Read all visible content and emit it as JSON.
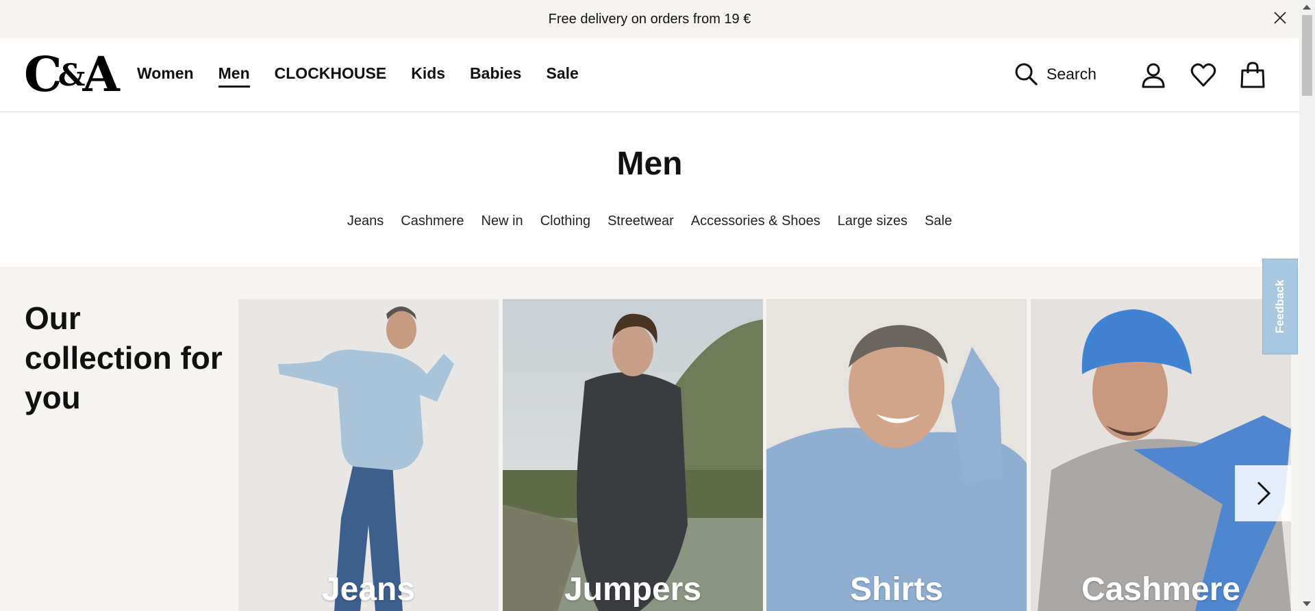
{
  "promo": {
    "text": "Free delivery on orders from 19 €"
  },
  "header": {
    "logo": {
      "left": "C",
      "amp": "&",
      "right": "A"
    },
    "nav": [
      "Women",
      "Men",
      "CLOCKHOUSE",
      "Kids",
      "Babies",
      "Sale"
    ],
    "active_nav": "Men",
    "search_label": "Search"
  },
  "page": {
    "title": "Men",
    "subnav": [
      "Jeans",
      "Cashmere",
      "New in",
      "Clothing",
      "Streetwear",
      "Accessories & Shoes",
      "Large sizes",
      "Sale"
    ]
  },
  "collection": {
    "title": "Our collection for you",
    "tiles": [
      "Jeans",
      "Jumpers",
      "Shirts",
      "Cashmere"
    ]
  },
  "feedback": {
    "label": "Feedback"
  },
  "colors": {
    "background_band": "#f5f4f0",
    "feedback": "#a8c8e2"
  }
}
